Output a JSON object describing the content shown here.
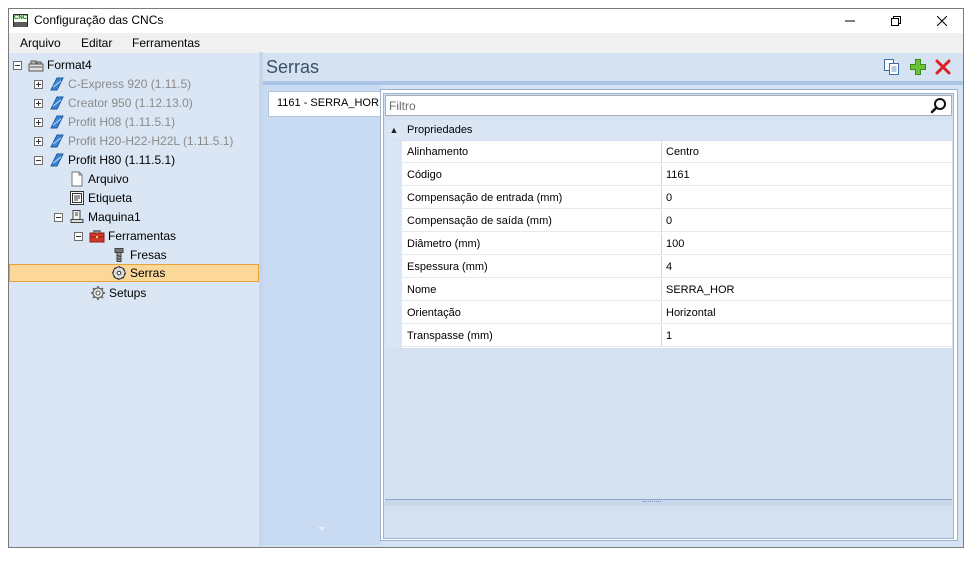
{
  "window": {
    "title": "Configuração das CNCs",
    "app_icon_text": "CNC",
    "controls": [
      "minimize-icon",
      "maximize-icon",
      "close-icon"
    ]
  },
  "menu": [
    "Arquivo",
    "Editar",
    "Ferramentas"
  ],
  "tree": [
    {
      "label": "Format4",
      "expander": "minus",
      "icon": "folder-machine-icon",
      "muted": false
    },
    {
      "label": "C-Express 920 (1.11.5)",
      "expander": "plus",
      "icon": "cnc-machine-icon",
      "muted": true
    },
    {
      "label": "Creator 950 (1.12.13.0)",
      "expander": "plus",
      "icon": "cnc-machine-icon",
      "muted": true
    },
    {
      "label": "Profit H08 (1.11.5.1)",
      "expander": "plus",
      "icon": "cnc-machine-icon",
      "muted": true
    },
    {
      "label": "Profit H20-H22-H22L (1.11.5.1)",
      "expander": "plus",
      "icon": "cnc-machine-icon",
      "muted": true
    },
    {
      "label": "Profit H80 (1.11.5.1)",
      "expander": "minus",
      "icon": "cnc-machine-icon",
      "muted": false
    },
    {
      "label": "Arquivo",
      "expander": null,
      "icon": "document-icon",
      "muted": false
    },
    {
      "label": "Etiqueta",
      "expander": null,
      "icon": "label-icon",
      "muted": false
    },
    {
      "label": "Maquina1",
      "expander": "minus",
      "icon": "machine-icon",
      "muted": false
    },
    {
      "label": "Ferramentas",
      "expander": "minus",
      "icon": "toolbox-icon",
      "muted": false
    },
    {
      "label": "Fresas",
      "expander": null,
      "icon": "mill-icon",
      "muted": false
    },
    {
      "label": "Serras",
      "expander": null,
      "icon": "saw-icon",
      "muted": false,
      "selected": true
    },
    {
      "label": "Setups",
      "expander": null,
      "icon": "gear-icon",
      "muted": false
    }
  ],
  "section": {
    "title": "Serras",
    "toolbar": [
      "copy-icon",
      "add-icon",
      "delete-icon"
    ]
  },
  "tabs": [
    "1161 - SERRA_HOR"
  ],
  "filter": {
    "placeholder": "Filtro",
    "value": ""
  },
  "property_grid": {
    "category": "Propriedades",
    "rows": [
      {
        "name": "Alinhamento",
        "value": "Centro"
      },
      {
        "name": "Código",
        "value": "1161"
      },
      {
        "name": "Compensação de entrada (mm)",
        "value": "0"
      },
      {
        "name": "Compensação de saída (mm)",
        "value": "0"
      },
      {
        "name": "Diâmetro (mm)",
        "value": "100"
      },
      {
        "name": "Espessura (mm)",
        "value": "4"
      },
      {
        "name": "Nome",
        "value": "SERRA_HOR"
      },
      {
        "name": "Orientação",
        "value": "Horizontal"
      },
      {
        "name": "Transpasse (mm)",
        "value": "1"
      }
    ]
  },
  "colors": {
    "tree_bg": "#dbe6f4",
    "selection": "#fcd79a",
    "title_text": "#3b4f6b",
    "add_green": "#5cb82e",
    "delete_red": "#e02020"
  }
}
